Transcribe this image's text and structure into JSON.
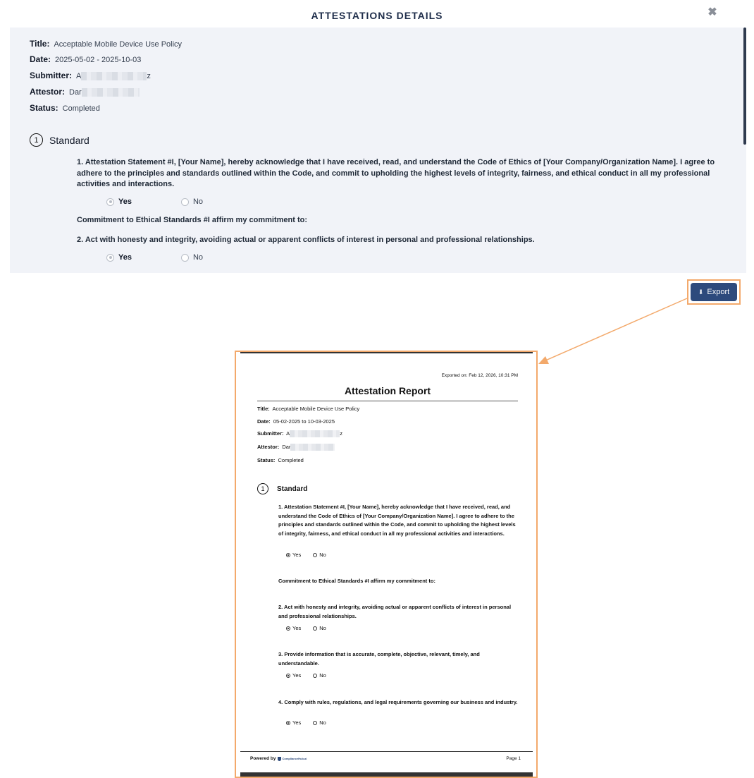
{
  "modal": {
    "title": "ATTESTATIONS DETAILS",
    "close_icon": "close-icon"
  },
  "details": {
    "title_label": "Title:",
    "title_value": "Acceptable Mobile Device Use Policy",
    "date_label": "Date:",
    "date_value": "2025-05-02 - 2025-10-03",
    "submitter_label": "Submitter:",
    "submitter_prefix": "A",
    "submitter_suffix": "z",
    "attestor_label": "Attestor:",
    "attestor_prefix": "Dar",
    "status_label": "Status:",
    "status_value": "Completed"
  },
  "section": {
    "number": "1",
    "title": "Standard"
  },
  "questions": [
    {
      "text": "1. Attestation Statement #I, [Your Name], hereby acknowledge that I have received, read, and understand the Code of Ethics of [Your Company/Organization Name]. I agree to adhere to the principles and standards outlined within the Code, and commit to upholding the highest levels of integrity, fairness, and ethical conduct in all my professional activities and interactions.",
      "yes": "Yes",
      "no": "No",
      "selected": "Yes"
    },
    {
      "text": "Commitment to Ethical Standards #I affirm my commitment to:"
    },
    {
      "text": "2. Act with honesty and integrity, avoiding actual or apparent conflicts of interest in personal and professional relationships.",
      "yes": "Yes",
      "no": "No",
      "selected": "Yes"
    }
  ],
  "export_button": {
    "icon": "download-icon",
    "label": "Export"
  },
  "report": {
    "exported_on": "Exported on: Feb 12, 2026, 10:31 PM",
    "title": "Attestation Report",
    "title_label": "Title:",
    "title_value": "Acceptable Mobile Device Use Policy",
    "date_label": "Date:",
    "date_value": "05-02-2025 to 10-03-2025",
    "submitter_label": "Submitter:",
    "submitter_prefix": "A",
    "submitter_suffix": "z",
    "attestor_label": "Attestor:",
    "attestor_prefix": "Dar",
    "status_label": "Status:",
    "status_value": "Completed",
    "section_number": "1",
    "section_title": "Standard",
    "q1": "1. Attestation Statement  #I, [Your Name], hereby acknowledge that I have received, read, and understand the Code of Ethics of [Your Company/Organization Name]. I agree to adhere to the principles and standards outlined within the Code, and commit to upholding the highest levels of integrity, fairness, and ethical conduct in all my professional activities and interactions.",
    "commitment": "Commitment to Ethical Standards #I affirm my commitment to:",
    "q2": "2. Act with honesty and integrity, avoiding actual or apparent conflicts of interest in personal and professional relationships.",
    "q3": "3. Provide information that is accurate, complete, objective, relevant, timely, and understandable.",
    "q4": "4. Comply with rules, regulations, and legal requirements governing our business and industry.",
    "yes": "Yes",
    "no": "No",
    "powered_by": "Powered by",
    "logo_text": "ComplianceHub.ai",
    "page": "Page 1"
  },
  "colors": {
    "accent": "#2d4a7c",
    "highlight": "#f3a96b",
    "panel_bg": "#f1f3f8"
  }
}
